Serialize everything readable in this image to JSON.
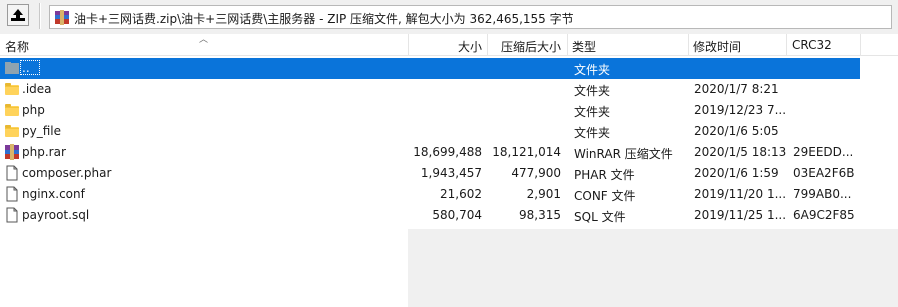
{
  "toolbar": {
    "path": "油卡+三网话费.zip\\油卡+三网话费\\主服务器 - ZIP 压缩文件, 解包大小为 362,465,155 字节"
  },
  "columns": {
    "name": "名称",
    "size": "大小",
    "packed": "压缩后大小",
    "type": "类型",
    "modified": "修改时间",
    "crc": "CRC32"
  },
  "files": [
    {
      "name": "..",
      "size": "",
      "packed": "",
      "type": "文件夹",
      "modified": "",
      "crc": "",
      "icon": "parent-folder-icon"
    },
    {
      "name": ".idea",
      "size": "",
      "packed": "",
      "type": "文件夹",
      "modified": "2020/1/7 8:21",
      "crc": "",
      "icon": "folder-icon"
    },
    {
      "name": "php",
      "size": "",
      "packed": "",
      "type": "文件夹",
      "modified": "2019/12/23 7...",
      "crc": "",
      "icon": "folder-icon"
    },
    {
      "name": "py_file",
      "size": "",
      "packed": "",
      "type": "文件夹",
      "modified": "2020/1/6 5:05",
      "crc": "",
      "icon": "folder-icon"
    },
    {
      "name": "php.rar",
      "size": "18,699,488",
      "packed": "18,121,014",
      "type": "WinRAR 压缩文件",
      "modified": "2020/1/5 18:13",
      "crc": "29EEDD...",
      "icon": "rar-archive-icon"
    },
    {
      "name": "composer.phar",
      "size": "1,943,457",
      "packed": "477,900",
      "type": "PHAR 文件",
      "modified": "2020/1/6 1:59",
      "crc": "03EA2F6B",
      "icon": "file-icon"
    },
    {
      "name": "nginx.conf",
      "size": "21,602",
      "packed": "2,901",
      "type": "CONF 文件",
      "modified": "2019/11/20 1...",
      "crc": "799AB0...",
      "icon": "file-icon"
    },
    {
      "name": "payroot.sql",
      "size": "580,704",
      "packed": "98,315",
      "type": "SQL 文件",
      "modified": "2019/11/25 1...",
      "crc": "6A9C2F85",
      "icon": "file-icon"
    }
  ],
  "colors": {
    "selection": "#0a74da",
    "folder": "#ffd35b",
    "toolbar_bg": "#f0f0f0"
  }
}
